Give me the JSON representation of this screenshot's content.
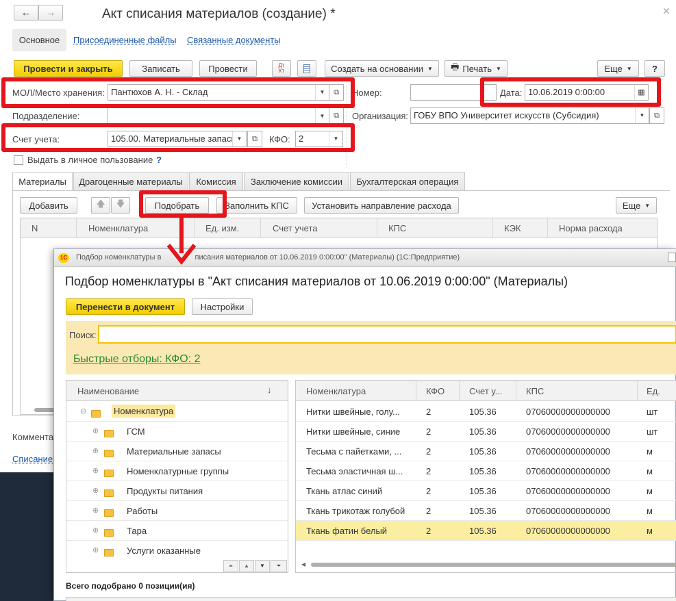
{
  "main": {
    "title": "Акт списания материалов (создание) *",
    "nav_tabs": [
      "Основное",
      "Присоединенные файлы",
      "Связанные документы"
    ],
    "toolbar": {
      "post_close": "Провести и закрыть",
      "save": "Записать",
      "post": "Провести",
      "dtkt_top": "Дт",
      "dtkt_bottom": "Кт",
      "create_based": "Создать на основании",
      "print": "Печать",
      "more": "Еще",
      "help": "?"
    },
    "fields": {
      "mol_label": "МОЛ/Место хранения:",
      "mol_value": "Пантюхов А. Н. - Склад",
      "number_label": "Номер:",
      "number_value": "",
      "date_label": "Дата:",
      "date_value": "10.06.2019  0:00:00",
      "division_label": "Подразделение:",
      "division_value": "",
      "org_label": "Организация:",
      "org_value": "ГОБУ ВПО Университет искусств (Субсидия)",
      "account_label": "Счет учета:",
      "account_value": "105.00. Материальные запасы",
      "kfo_label": "КФО:",
      "kfo_value": "2",
      "personal_use_label": "Выдать в личное пользование",
      "personal_use_help": "?"
    },
    "tabs": [
      "Материалы",
      "Драгоценные материалы",
      "Комиссия",
      "Заключение комиссии",
      "Бухгалтерская операция"
    ],
    "materials_toolbar": {
      "add": "Добавить",
      "pick": "Подобрать",
      "fill_kps": "Заполнить КПС",
      "set_direction": "Установить направление расхода",
      "more": "Еще"
    },
    "columns": [
      "N",
      "Номенклатура",
      "Ед. изм.",
      "Счет учета",
      "КПС",
      "КЭК",
      "Норма расхода"
    ],
    "comment_label": "Коммента",
    "footer_link": "Списание"
  },
  "picker": {
    "window_title": "Подбор номенклатуры в \"Акт списания материалов от 10.06.2019 0:00:00\"  (Материалы)  (1С:Предприятие)",
    "window_title_short_a": "Подбор номенклатуры в ",
    "window_title_short_b": "писания материалов от 10.06.2019 0:00:00\"  (Материалы)  (1С:Предприятие)",
    "app_logo": "1С",
    "heading": "Подбор номенклатуры в \"Акт списания материалов от 10.06.2019 0:00:00\"  (Материалы)",
    "transfer": "Перенести в документ",
    "settings": "Настройки",
    "search_label": "Поиск:",
    "search_value": "",
    "quick_filters": "Быстрые отборы: КФО: 2",
    "tree_header": "Наименование",
    "tree_sort": "↓",
    "tree_root": "Номенклатура",
    "tree_items": [
      "ГСМ",
      "Материальные запасы",
      "Номенклатурные группы",
      "Продукты питания",
      "Работы",
      "Тара",
      "Услуги оказанные"
    ],
    "list_columns": [
      "Номенклатура",
      "КФО",
      "Счет у...",
      "КПС",
      "Ед."
    ],
    "list_rows": [
      {
        "name": "Нитки швейные, голу...",
        "kfo": "2",
        "account": "105.36",
        "kps": "07060000000000000",
        "unit": "шт"
      },
      {
        "name": "Нитки швейные, синие",
        "kfo": "2",
        "account": "105.36",
        "kps": "07060000000000000",
        "unit": "шт"
      },
      {
        "name": "Тесьма с пайетками, ...",
        "kfo": "2",
        "account": "105.36",
        "kps": "07060000000000000",
        "unit": "м"
      },
      {
        "name": "Тесьма эластичная ш...",
        "kfo": "2",
        "account": "105.36",
        "kps": "07060000000000000",
        "unit": "м"
      },
      {
        "name": "Ткань атлас синий",
        "kfo": "2",
        "account": "105.36",
        "kps": "07060000000000000",
        "unit": "м"
      },
      {
        "name": "Ткань трикотаж голубой",
        "kfo": "2",
        "account": "105.36",
        "kps": "07060000000000000",
        "unit": "м"
      },
      {
        "name": "Ткань фатин белый",
        "kfo": "2",
        "account": "105.36",
        "kps": "07060000000000000",
        "unit": "м"
      }
    ],
    "total": "Всего подобрано 0 позиции(ия)"
  },
  "colors": {
    "highlight_red": "#e5151c",
    "accent_yellow": "#f2cd00",
    "selected_row": "#fbeea0",
    "link_green": "#2a8a2a"
  }
}
